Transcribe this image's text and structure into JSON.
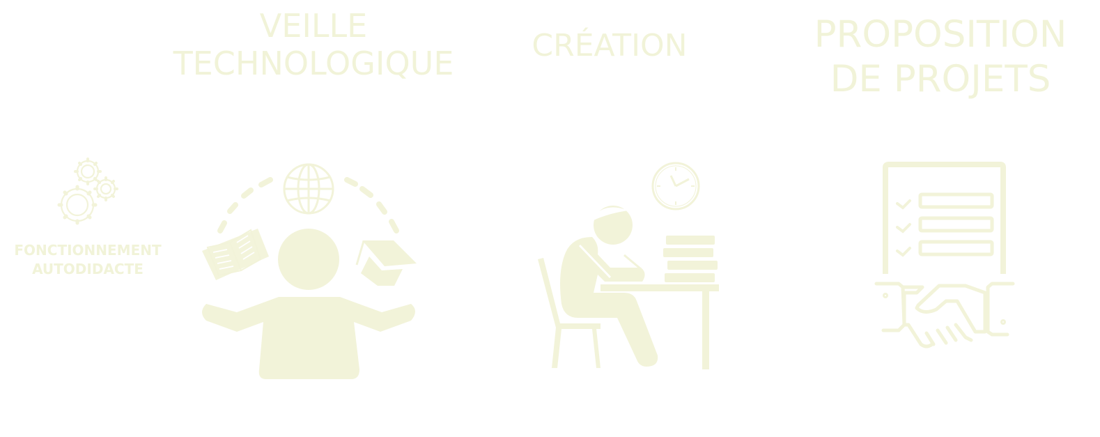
{
  "headings": {
    "veille": [
      "VEILLE",
      "TECHNOLOGIQUE"
    ],
    "creation": "CRÉATION",
    "proposition": [
      "PROPOSITION",
      "DE PROJETS"
    ],
    "fonctionnement": [
      "FONCTIONNEMENT",
      "AUTODIDACTE"
    ]
  },
  "colors": {
    "background": "#ffffff",
    "foreground": "#f2f3d9"
  },
  "icons": [
    "gears-icon",
    "person-juggling-books-globe-graduation-cap-icon",
    "person-studying-at-desk-icon",
    "wall-clock-icon",
    "checklist-board-icon",
    "handshake-icon"
  ]
}
